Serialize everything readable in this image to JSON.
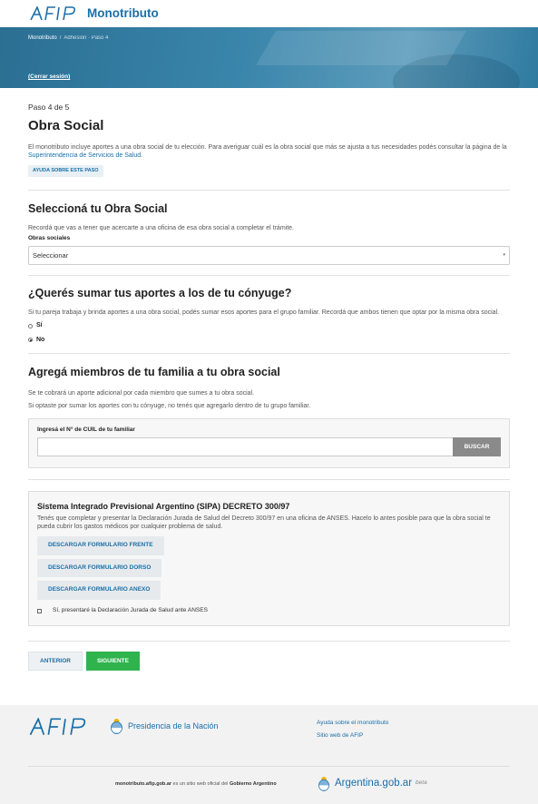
{
  "header": {
    "logo_text": "AFIP",
    "app_title": "Monotributo"
  },
  "breadcrumb": {
    "home": "Monotributo",
    "separator": "/",
    "current": "Adhesión · Paso 4"
  },
  "logout_label": "(Cerrar sesión)",
  "step_indicator": "Paso 4 de 5",
  "obra_social": {
    "title": "Obra Social",
    "desc_text": "El monotributo incluye aportes a una obra social de tu elección. Para averiguar cuál es la obra social que más se ajusta a tus necesidades podés consultar la página de la",
    "desc_link": "Superintendencia de Servicios de Salud",
    "desc_end": ".",
    "help_label": "AYUDA SOBRE ESTE PASO"
  },
  "select_section": {
    "title": "Seleccioná tu Obra Social",
    "desc": "Recordá que vas a tener que acercarte a una oficina de esa obra social a completar el trámite.",
    "field_label": "Obras sociales",
    "selected_value": "Seleccionar",
    "caret": "▾"
  },
  "spouse_section": {
    "title": "¿Querés sumar tus aportes a los de tu cónyuge?",
    "desc": "Si tu pareja trabaja y brinda aportes a una obra social, podés sumar esos aportes para el grupo familiar. Recordá que ambos tienen que optar por la misma obra social.",
    "options": [
      "Sí",
      "No"
    ],
    "selected": "No"
  },
  "family_section": {
    "title": "Agregá miembros de tu familia a tu obra social",
    "desc1": "Se te cobrará un aporte adicional por cada miembro que sumes a tu obra social.",
    "desc2": "Si optaste por sumar los aportes con tu cónyuge, no tenés que agregarlo dentro de tu grupo familiar.",
    "cuil_label": "Ingresá el N° de CUIL de tu familiar",
    "cuil_value": "",
    "search_label": "BUSCAR"
  },
  "sipa_section": {
    "title": "Sistema Integrado Previsional Argentino (SIPA) DECRETO 300/97",
    "desc": "Tenés que completar y presentar la Declaración Jurada de Salud del Decreto 300/97 en una oficina de ANSES. Hacelo lo antes posible para que la obra social te pueda cubrir los gastos médicos por cualquier problema de salud.",
    "buttons": [
      "DESCARGAR FORMULARIO FRENTE",
      "DESCARGAR FORMULARIO DORSO",
      "DESCARGAR FORMULARIO ANEXO"
    ],
    "checkbox_label": "Sí, presentaré la Declaración Jurada de Salud ante ANSES",
    "checked": false
  },
  "nav": {
    "prev_label": "ANTERIOR",
    "next_label": "SIGUIENTE"
  },
  "footer": {
    "afip_logo": "AFIP",
    "presidencia": "Presidencia de la Nación",
    "links": [
      "Ayuda sobre el monotributo",
      "Sitio web de AFIP"
    ],
    "domain": "monotributo.afip.gob.ar",
    "note_mid": " es un sitio web oficial del ",
    "gov": "Gobierno Argentino",
    "argentina_brand": "Argentina.gob.ar",
    "beta": "beta"
  },
  "colors": {
    "brand_blue": "#1b6fa8",
    "hero_blue": "#3a85ab",
    "primary_green": "#2fb34d",
    "search_gray": "#8a8a8a"
  }
}
